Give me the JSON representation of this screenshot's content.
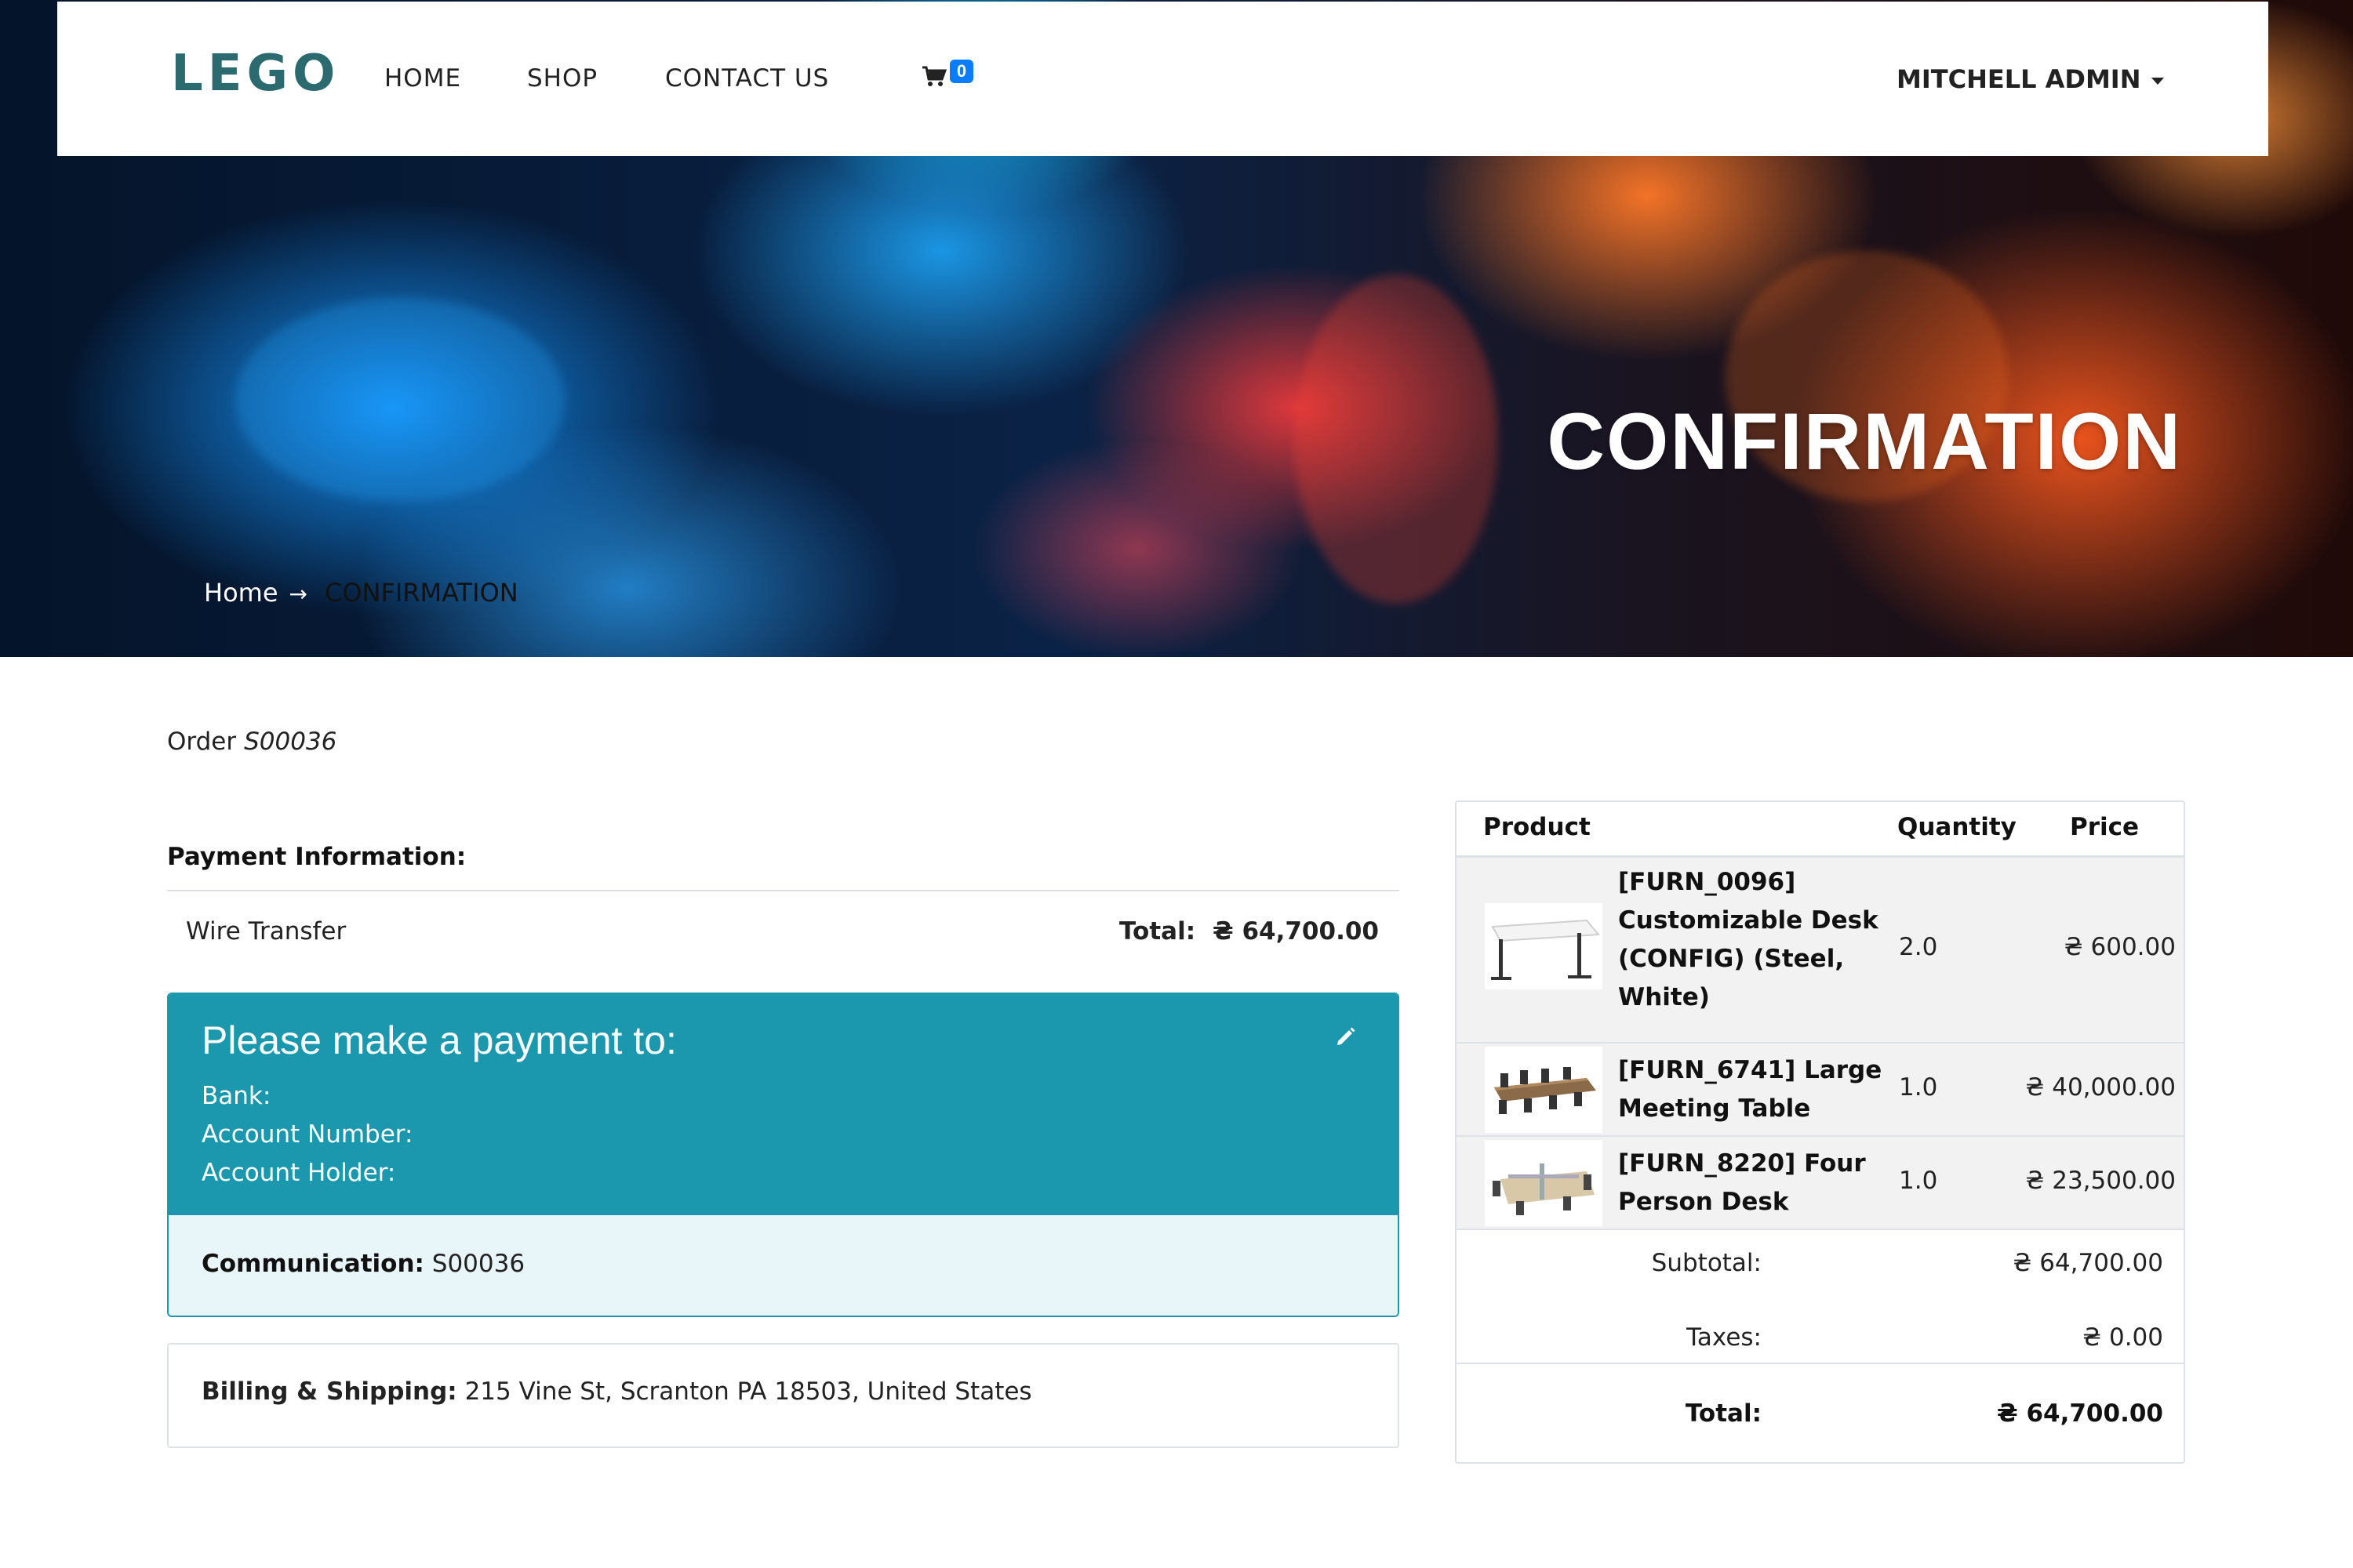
{
  "nav": {
    "logo": "LEGO",
    "links": [
      "HOME",
      "SHOP",
      "CONTACT US"
    ],
    "cart_count": "0",
    "user": "MITCHELL ADMIN"
  },
  "hero": {
    "title": "CONFIRMATION",
    "breadcrumb_home": "Home",
    "breadcrumb_sep": "→",
    "breadcrumb_current": "CONFIRMATION"
  },
  "order": {
    "label": "Order",
    "number": "S00036"
  },
  "payment": {
    "section_title": "Payment Information:",
    "method": "Wire Transfer",
    "total_label": "Total:",
    "total_value": "₴ 64,700.00",
    "instructions_heading": "Please make a payment to:",
    "bank_label": "Bank:",
    "account_number_label": "Account Number:",
    "account_holder_label": "Account Holder:",
    "communication_label": "Communication:",
    "communication_value": "S00036"
  },
  "billing": {
    "label": "Billing & Shipping:",
    "address": "215 Vine St, Scranton PA 18503, United States"
  },
  "summary": {
    "headers": {
      "product": "Product",
      "quantity": "Quantity",
      "price": "Price"
    },
    "items": [
      {
        "name": "[FURN_0096] Customizable Desk (CONFIG) (Steel, White)",
        "qty": "2.0",
        "price": "₴ 600.00"
      },
      {
        "name": "[FURN_6741] Large Meeting Table",
        "qty": "1.0",
        "price": "₴ 40,000.00"
      },
      {
        "name": "[FURN_8220] Four Person Desk",
        "qty": "1.0",
        "price": "₴ 23,500.00"
      }
    ],
    "subtotal_label": "Subtotal:",
    "subtotal_value": "₴ 64,700.00",
    "taxes_label": "Taxes:",
    "taxes_value": "₴ 0.00",
    "total_label": "Total:",
    "total_value": "₴ 64,700.00"
  },
  "colors": {
    "logo": "#2b6a6e",
    "alert": "#1b98ae",
    "alert_light": "#e8f6fa",
    "badge": "#0a7cff"
  }
}
